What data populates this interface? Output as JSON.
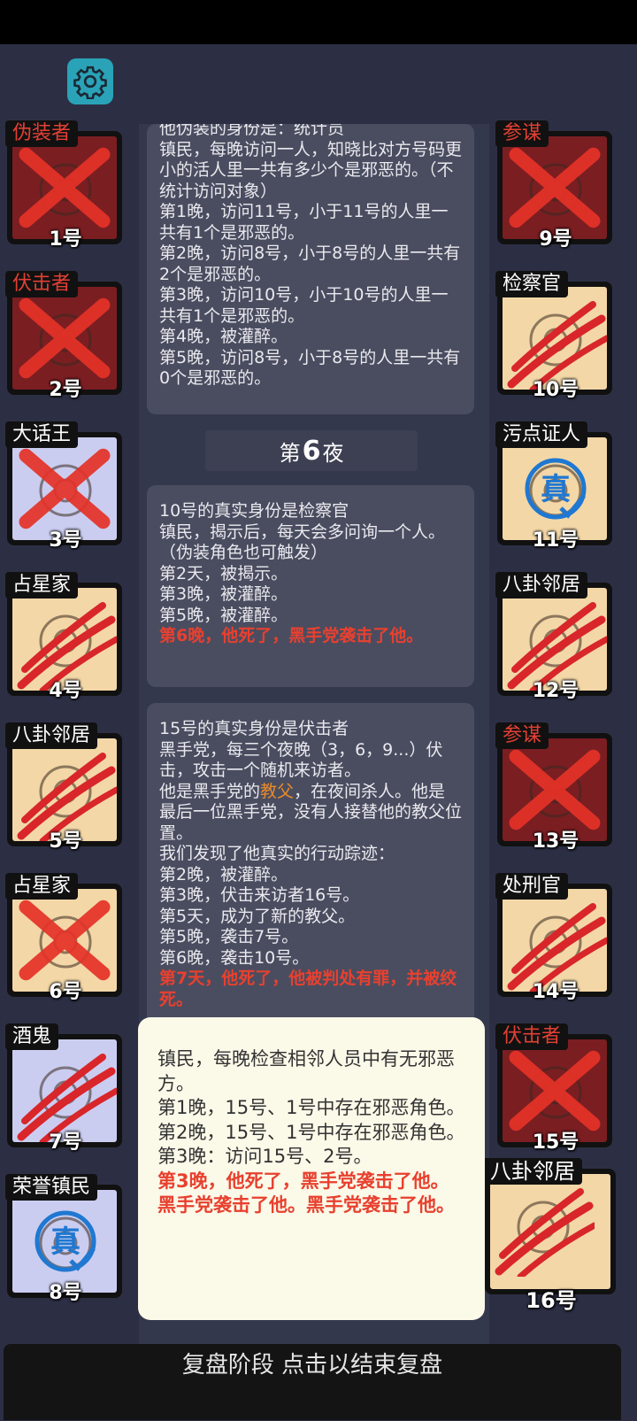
{
  "settings": {
    "icon": "gear-icon"
  },
  "colors": {
    "accent_red": "#e8402f",
    "gear_bg": "#2aa3b8"
  },
  "players_left": [
    {
      "role": "伪装者",
      "number": "1号",
      "style": "red",
      "status": "crossed",
      "role_color": "red"
    },
    {
      "role": "伏击者",
      "number": "2号",
      "style": "red",
      "status": "crossed",
      "role_color": "red"
    },
    {
      "role": "大话王",
      "number": "3号",
      "style": "lav",
      "status": "crossed",
      "role_color": "white"
    },
    {
      "role": "占星家",
      "number": "4号",
      "style": "tan",
      "status": "clawed",
      "role_color": "white"
    },
    {
      "role": "八卦邻居",
      "number": "5号",
      "style": "tan",
      "status": "clawed",
      "role_color": "white"
    },
    {
      "role": "占星家",
      "number": "6号",
      "style": "tan",
      "status": "crossed",
      "role_color": "white"
    },
    {
      "role": "酒鬼",
      "number": "7号",
      "style": "lav",
      "status": "clawed",
      "role_color": "white"
    },
    {
      "role": "荣誉镇民",
      "number": "8号",
      "style": "lav",
      "status": "true",
      "role_color": "white"
    }
  ],
  "players_right": [
    {
      "role": "参谋",
      "number": "9号",
      "style": "red",
      "status": "crossed",
      "role_color": "red"
    },
    {
      "role": "检察官",
      "number": "10号",
      "style": "tan",
      "status": "clawed",
      "role_color": "white"
    },
    {
      "role": "污点证人",
      "number": "11号",
      "style": "tan",
      "status": "true",
      "role_color": "white"
    },
    {
      "role": "八卦邻居",
      "number": "12号",
      "style": "tan",
      "status": "clawed",
      "role_color": "white"
    },
    {
      "role": "参谋",
      "number": "13号",
      "style": "red",
      "status": "crossed",
      "role_color": "red"
    },
    {
      "role": "处刑官",
      "number": "14号",
      "style": "tan",
      "status": "clawed",
      "role_color": "white"
    },
    {
      "role": "伏击者",
      "number": "15号",
      "style": "red",
      "status": "crossed",
      "role_color": "red"
    },
    {
      "role": "八卦邻居",
      "number": "16号",
      "style": "tan",
      "status": "clawed",
      "role_color": "white"
    }
  ],
  "true_badge": "真",
  "log1": {
    "lines": [
      {
        "text": "他伪装的身份是：统计员",
        "hl": false
      },
      {
        "text": "镇民，每晚访问一人，知晓比对方号码更小的活人里一共有多少个是邪恶的。（不统计访问对象）",
        "hl": false
      },
      {
        "text": "第1晚，访问11号，小于11号的人里一共有1个是邪恶的。",
        "hl": false
      },
      {
        "text": "第2晚，访问8号，小于8号的人里一共有2个是邪恶的。",
        "hl": false
      },
      {
        "text": "第3晚，访问10号，小于10号的人里一共有1个是邪恶的。",
        "hl": false
      },
      {
        "text": "第4晚，被灌醉。",
        "hl": false
      },
      {
        "text": "第5晚，访问8号，小于8号的人里一共有0个是邪恶的。",
        "hl": false
      }
    ]
  },
  "night_banner": {
    "prefix": "第",
    "number": "6",
    "suffix": "夜"
  },
  "log2": {
    "lines": [
      {
        "text": "10号的真实身份是检察官",
        "hl": false
      },
      {
        "text": "镇民，揭示后，每天会多问询一个人。（伪装角色也可触发）",
        "hl": false
      },
      {
        "text": "第2天，被揭示。",
        "hl": false
      },
      {
        "text": "第3晚，被灌醉。",
        "hl": false
      },
      {
        "text": "第5晚，被灌醉。",
        "hl": false
      },
      {
        "text": "第6晚，他死了，黑手党袭击了他。",
        "hl": true
      }
    ]
  },
  "log3": {
    "line1": "15号的真实身份是伏击者",
    "line2": "黑手党，每三个夜晚（3，6，9...）伏击，攻击一个随机来访者。",
    "line3_pre": "他是黑手党的",
    "line3_word": "教父",
    "line3_post": "，在夜间杀人。他是最后一位黑手党，没有人接替他的教父位置。",
    "line4": "我们发现了他真实的行动踪迹：",
    "line5": "第2晚，被灌醉。",
    "line6": "第3晚，伏击来访者16号。",
    "line7": "第5天，成为了新的教父。",
    "line8": "第5晚，袭击7号。",
    "line9": "第6晚，袭击10号。",
    "line10": "第7天，他死了，他被判处有罪，并被绞死。"
  },
  "popup": {
    "line1": "镇民，每晚检查相邻人员中有无邪恶方。",
    "line2": "第1晚，15号、1号中存在邪恶角色。",
    "line3": "第2晚，15号、1号中存在邪恶角色。",
    "line4": "第3晚：访问15号、2号。",
    "line5": "第3晚，他死了，黑手党袭击了他。黑手党袭击了他。黑手党袭击了他。"
  },
  "bottom_bar": {
    "label": "复盘阶段 点击以结束复盘"
  }
}
